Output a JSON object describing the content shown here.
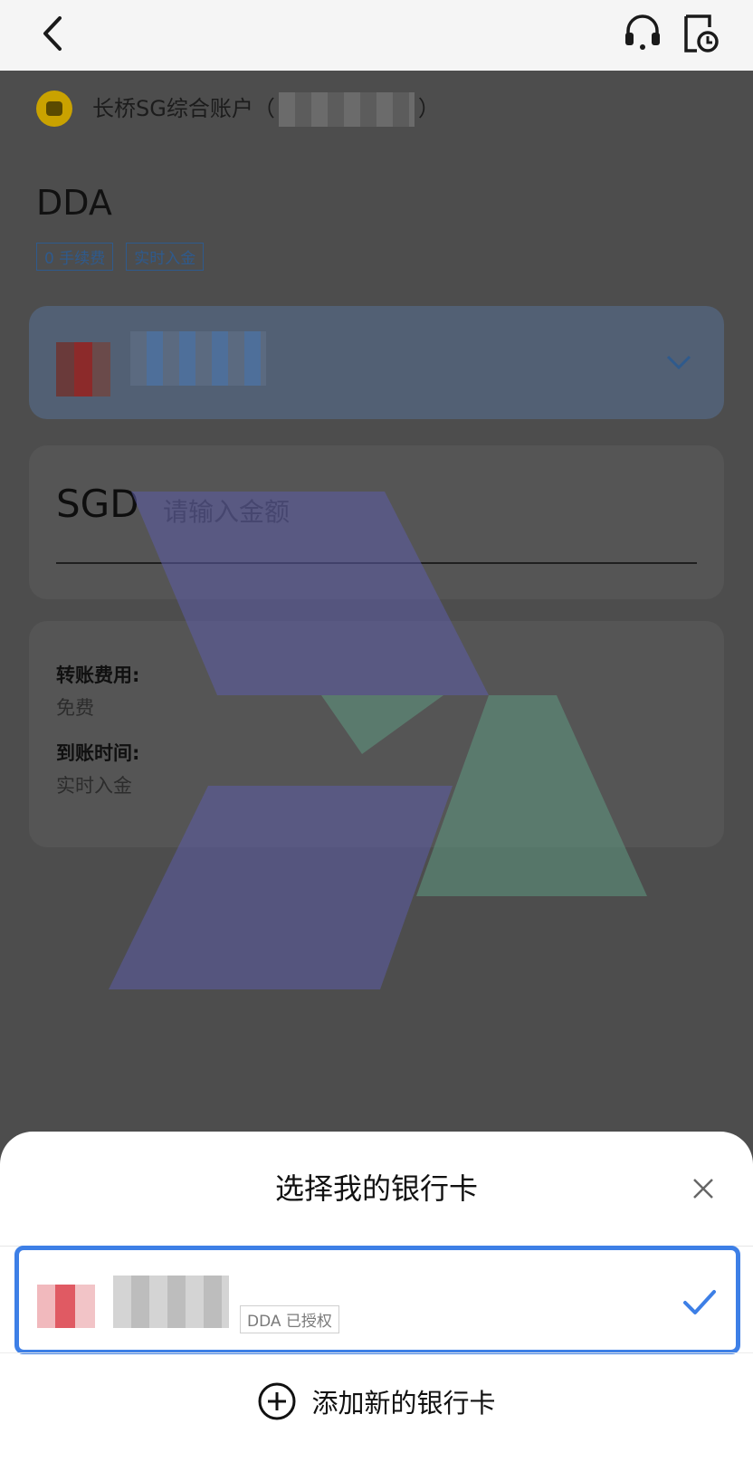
{
  "topbar": {
    "back_icon": "chevron-left-icon",
    "support_icon": "headset-icon",
    "history_icon": "clock-document-icon"
  },
  "account": {
    "name_prefix": "长桥SG综合账户（",
    "name_suffix": "）",
    "coin_color": "#c9a200"
  },
  "method": {
    "title": "DDA",
    "tags": [
      "0 手续费",
      "实时入金"
    ]
  },
  "bank_select": {
    "chevron_icon": "chevron-down-icon"
  },
  "amount": {
    "currency": "SGD",
    "placeholder": "请输入金额"
  },
  "details": {
    "fee_label": "转账费用:",
    "fee_value": "免费",
    "time_label": "到账时间:",
    "time_value": "实时入金"
  },
  "sheet": {
    "title": "选择我的银行卡",
    "close_icon": "close-icon",
    "selected_card_badge": "DDA 已授权",
    "selected_check_icon": "check-icon",
    "add_card_label": "添加新的银行卡",
    "accent_color": "#3d7fe6"
  }
}
